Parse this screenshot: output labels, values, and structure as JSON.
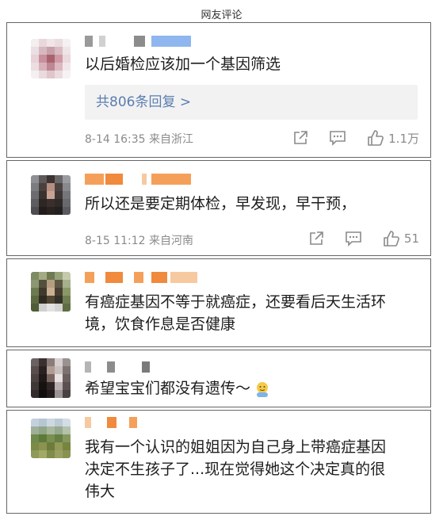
{
  "page_title": "网友评论",
  "comments": [
    {
      "text": "以后婚检应该加一个基因筛选",
      "reply_label": "共806条回复 >",
      "meta": "8-14 16:35  来自浙江",
      "like_count": "1.1万"
    },
    {
      "text": "所以还是要定期体检，早发现，早干预，",
      "meta": "8-15 11:12  来自河南",
      "like_count": "51"
    },
    {
      "text_line1": "有癌症基因不等于就癌症，还要看后天生活环",
      "text_line2": "境，饮食作息是否健康"
    },
    {
      "text": "希望宝宝们都没有遗传～"
    },
    {
      "text_line1": "我有一个认识的姐姐因为自己身上带癌症基因",
      "text_line2": "决定不生孩子了...现在觉得她这个决定真的很",
      "text_line3": "伟大"
    }
  ],
  "colors": {
    "reply_text": "#5a7db0",
    "meta_text": "#8a8a8a",
    "username_blur_orange": "#f5a05a",
    "username_blur_blue": "#8fb6ee",
    "username_blur_gray": "#b5b5b5"
  },
  "icons": [
    "share-icon",
    "comment-icon",
    "like-icon",
    "emoji-icon"
  ]
}
